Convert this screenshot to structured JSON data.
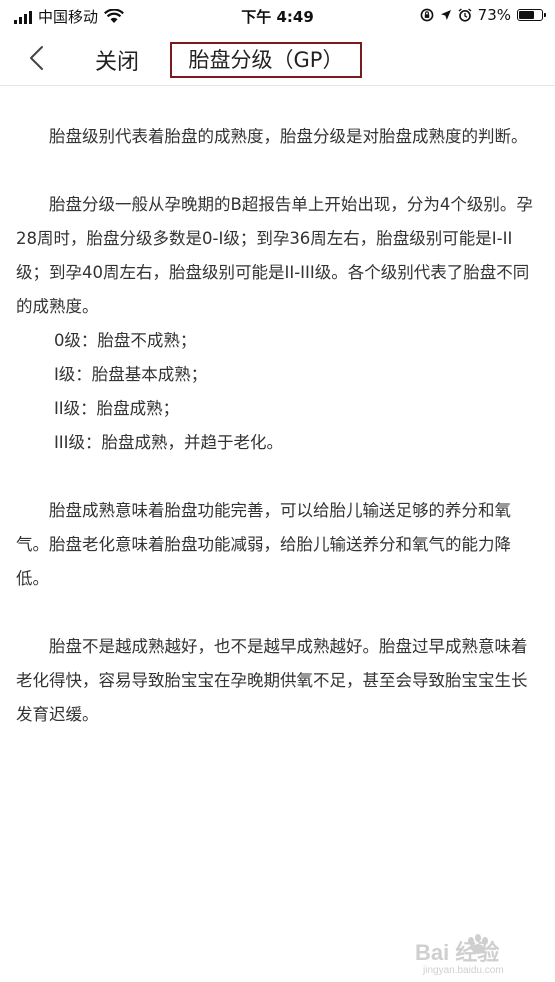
{
  "status_bar": {
    "carrier": "中国移动",
    "time": "下午 4:49",
    "battery_percent": "73%",
    "battery_level": 0.73,
    "icons": [
      "signal-icon",
      "wifi-icon",
      "screen-lock-icon",
      "location-icon",
      "alarm-icon",
      "battery-icon"
    ]
  },
  "nav": {
    "back_icon": "chevron-left-icon",
    "close_label": "关闭",
    "title": "胎盘分级（GP）"
  },
  "article": {
    "paragraphs": [
      "胎盘级别代表着胎盘的成熟度，胎盘分级是对胎盘成熟度的判断。",
      "胎盘分级一般从孕晚期的B超报告单上开始出现，分为4个级别。孕28周时，胎盘分级多数是0-I级；到孕36周左右，胎盘级别可能是I-II级；到孕40周左右，胎盘级别可能是II-III级。各个级别代表了胎盘不同的成熟度。",
      "胎盘成熟意味着胎盘功能完善，可以给胎儿输送足够的养分和氧气。胎盘老化意味着胎盘功能减弱，给胎儿输送养分和氧气的能力降低。",
      "胎盘不是越成熟越好，也不是越早成熟越好。胎盘过早成熟意味着老化得快，容易导致胎宝宝在孕晚期供氧不足，甚至会导致胎宝宝生长发育迟缓。"
    ],
    "levels": [
      "0级：胎盘不成熟；",
      "I级：胎盘基本成熟；",
      "II级：胎盘成熟；",
      "III级：胎盘成熟，并趋于老化。"
    ]
  },
  "watermark": {
    "logo_text": "Bai 经验",
    "url": "jingyan.baidu.com"
  },
  "colors": {
    "title_border": "#7b1a1e",
    "text": "#333333",
    "divider": "#e4e4e4"
  }
}
